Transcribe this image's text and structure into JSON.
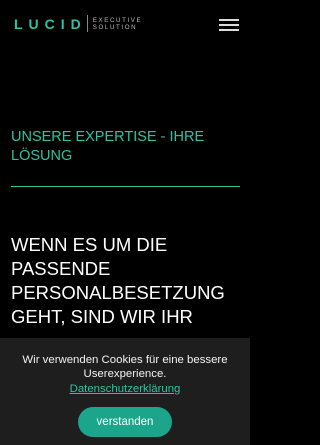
{
  "header": {
    "logo_word": "LUCID",
    "logo_sub_line1": "EXECUTIVE",
    "logo_sub_line2": "SOLUTION",
    "menu_icon": "hamburger-menu-icon"
  },
  "main": {
    "expertise_heading": "UNSERE EXPERTISE - IHRE LÖSUNG",
    "headline": "WENN ES UM DIE PASSENDE PERSONALBESETZUNG GEHT, SIND WIR IHR"
  },
  "cookie_banner": {
    "message": "Wir verwenden Cookies für eine bessere Userexperience.",
    "privacy_link": "Datenschutzerklärung",
    "accept_button": "verstanden"
  },
  "colors": {
    "accent": "#2ec4a0",
    "button": "#1ba58a",
    "background": "#000000"
  }
}
